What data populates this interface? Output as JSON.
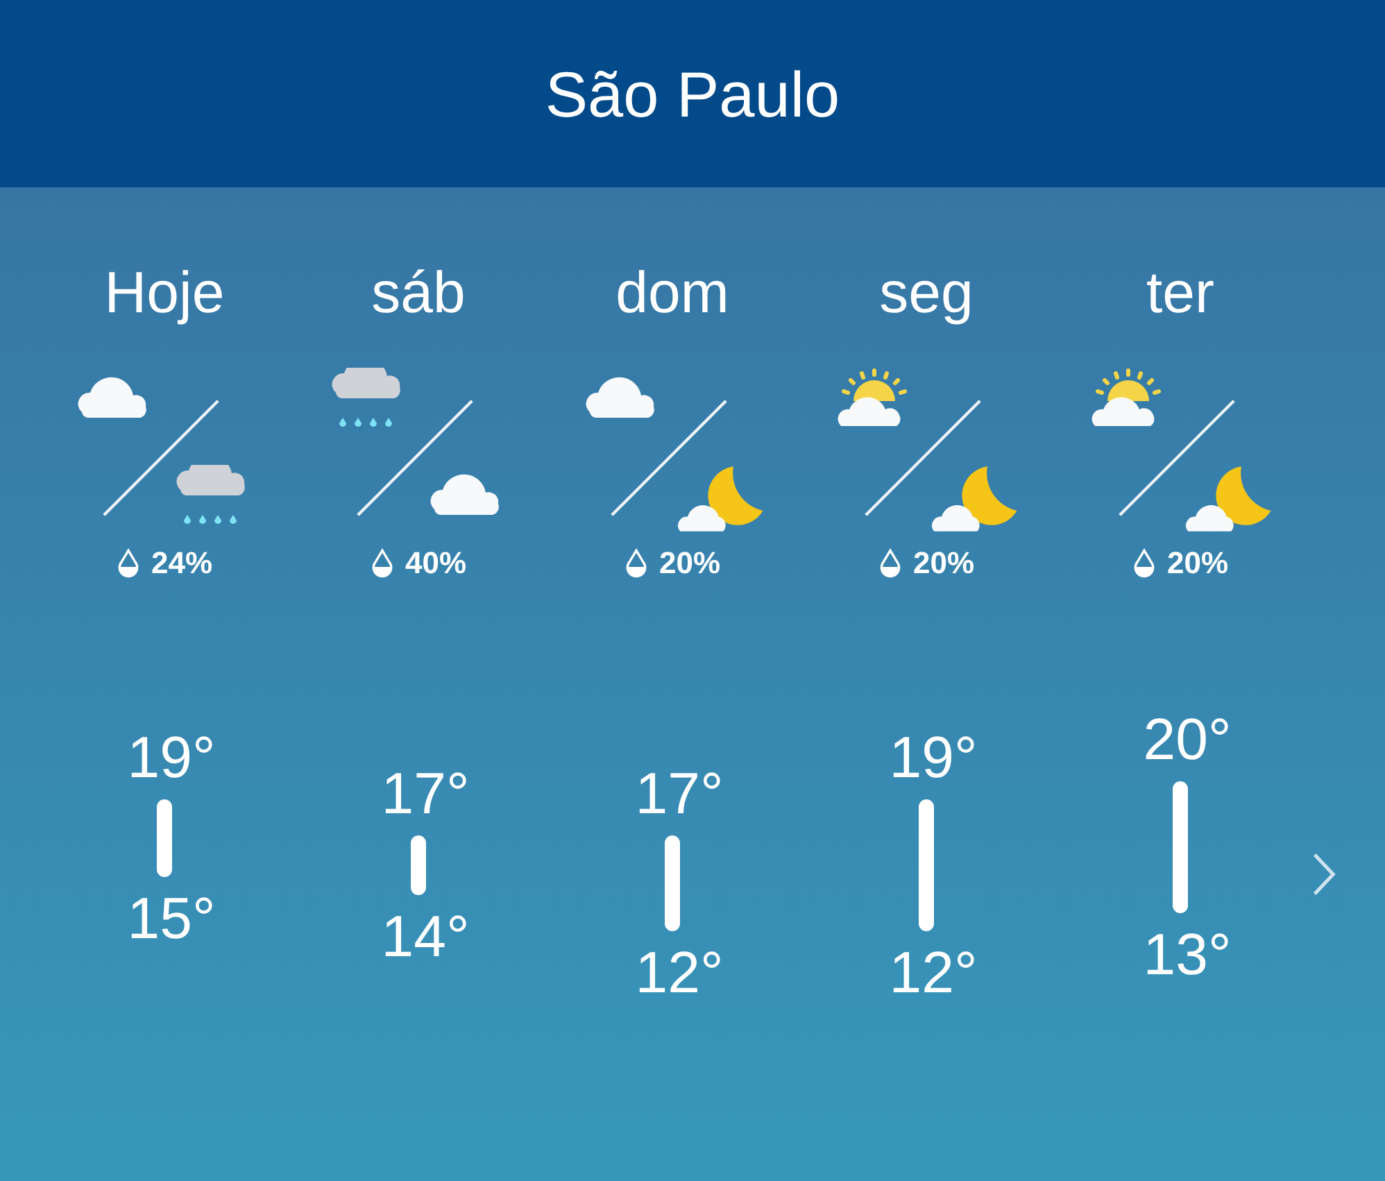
{
  "header": {
    "title": "São Paulo"
  },
  "days": [
    {
      "label": "Hoje",
      "icons": [
        {
          "kind": "cloud"
        },
        {
          "kind": "rain"
        }
      ],
      "precip": "24%",
      "high": "19°",
      "low": "15°"
    },
    {
      "label": "sáb",
      "icons": [
        {
          "kind": "rain"
        },
        {
          "kind": "cloud"
        }
      ],
      "precip": "40%",
      "high": "17°",
      "low": "14°"
    },
    {
      "label": "dom",
      "icons": [
        {
          "kind": "cloud"
        },
        {
          "kind": "moon-cloud"
        }
      ],
      "precip": "20%",
      "high": "17°",
      "low": "12°"
    },
    {
      "label": "seg",
      "icons": [
        {
          "kind": "sun-cloud"
        },
        {
          "kind": "moon-cloud"
        }
      ],
      "precip": "20%",
      "high": "19°",
      "low": "12°"
    },
    {
      "label": "ter",
      "icons": [
        {
          "kind": "sun-cloud"
        },
        {
          "kind": "moon-cloud"
        }
      ],
      "precip": "20%",
      "high": "20°",
      "low": "13°"
    }
  ]
}
